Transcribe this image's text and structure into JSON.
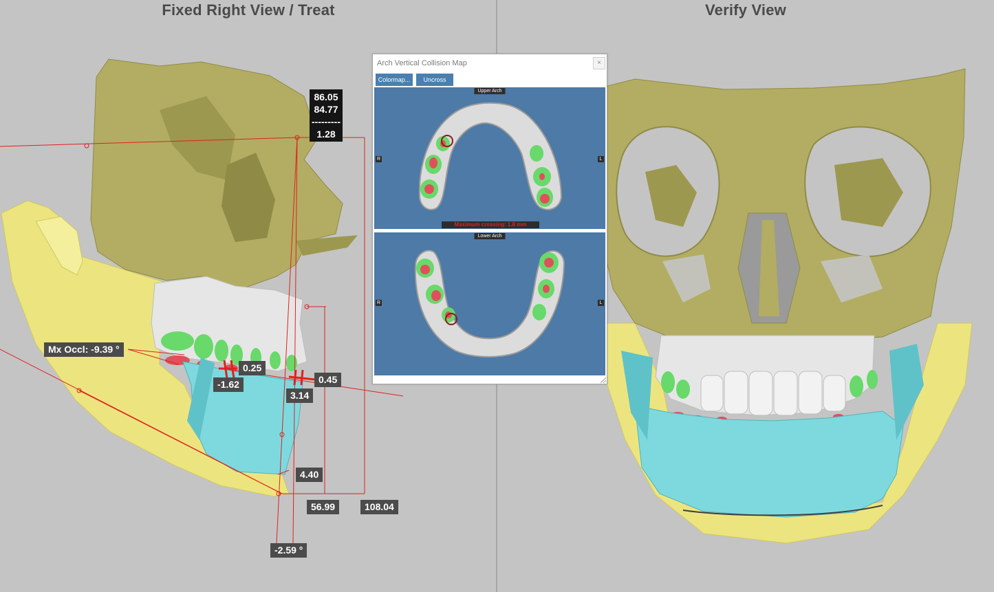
{
  "views": {
    "left_title": "Fixed Right View / Treat",
    "right_title": "Verify View"
  },
  "measurements": {
    "stack": [
      "86.05",
      "84.77",
      "---------",
      "1.28"
    ],
    "mx_occl": "Mx Occl: -9.39 °",
    "m_025": "0.25",
    "m_neg162": "-1.62",
    "m_045": "0.45",
    "m_314": "3.14",
    "m_440": "4.40",
    "m_5699": "56.99",
    "m_10804": "108.04",
    "m_neg259": "-2.59 °"
  },
  "dialog": {
    "title": "Arch Vertical Collision Map",
    "close": "×",
    "btn_colormap": "Colormap...",
    "btn_uncross": "Uncross",
    "upper_label": "Upper Arch",
    "lower_label": "Lower Arch",
    "side_right": "R",
    "side_left": "L",
    "max_crossing": "Maximum crossing: 1.8 mm"
  },
  "colors": {
    "bone": "#b2ad62",
    "mandible_yellow": "#ece57f",
    "lower_teeth_cyan": "#7ed9de",
    "upper_teeth_white": "#e6e6e6",
    "collision_green": "#68d96a",
    "collision_red": "#e0505a",
    "measure_line": "#e02020",
    "arch_bg": "#4d7aa6",
    "button_blue": "#4a7fb0"
  }
}
